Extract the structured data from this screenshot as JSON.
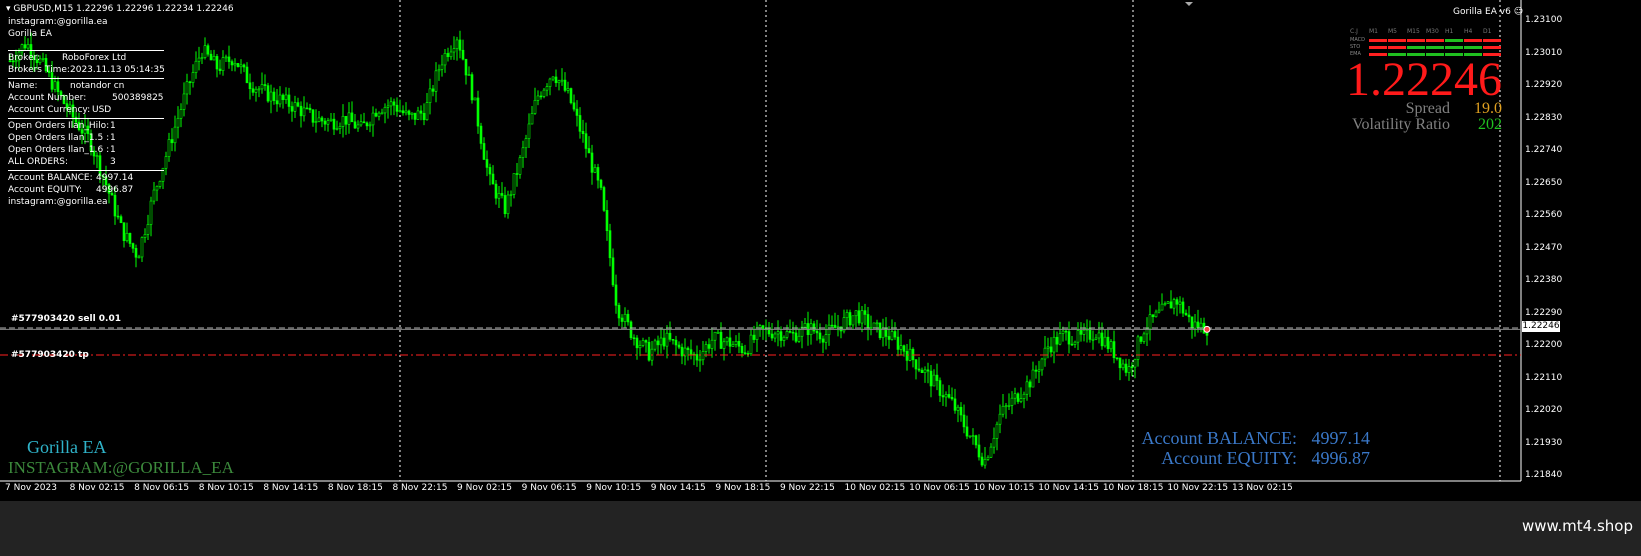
{
  "header": {
    "symbol_line": "GBPUSD,M15  1.22296 1.22296 1.22234 1.22246",
    "line2": "instagram:@gorilla.ea",
    "line3": "Gorilla EA",
    "ea_badge": "Gorilla EA  v6"
  },
  "info_panel": {
    "broker_label": "Broker:",
    "broker_value": "RoboForex Ltd",
    "broker_time_label": "Brokers Time:",
    "broker_time_value": "2023.11.13 05:14:35",
    "name_label": "Name:",
    "name_value": "notandor cn",
    "account_number_label": "Account Number:",
    "account_number_value": "500389825",
    "account_currency_label": "Account Currency:",
    "account_currency_value": "USD",
    "orders": [
      {
        "label": "Open Orders Ilan_Hilo:",
        "value": "1"
      },
      {
        "label": "Open Orders Ilan_1.5 :",
        "value": "1"
      },
      {
        "label": "Open Orders Ilan_1.6 :",
        "value": "1"
      },
      {
        "label": "ALL ORDERS:",
        "value": "3"
      }
    ],
    "balance_label": "Account BALANCE:",
    "balance_value": "4997.14",
    "equity_label": "Account EQUITY:",
    "equity_value": "4996.87",
    "footer_line": "instagram:@gorilla.ea"
  },
  "order_lines": {
    "sell_label": "#577903420 sell 0.01",
    "tp_label": "#577903420 tp"
  },
  "indicator_panel": {
    "timeframes": [
      "C.J",
      "M1",
      "M5",
      "M15",
      "M30",
      "H1",
      "H4",
      "D1"
    ],
    "rows": [
      "MACD",
      "STO",
      "EMA"
    ],
    "price": "1.22246",
    "spread_label": "Spread",
    "spread_value": "19.0",
    "volatility_label": "Volatility Ratio",
    "volatility_value": "202",
    "colors": {
      "price": "#ff1a1a",
      "spread": "#e0a020",
      "volatility": "#20c020",
      "labels": "#808080"
    }
  },
  "watermark": {
    "title": "Gorilla EA",
    "instagram": "INSTAGRAM:@GORILLA_EA"
  },
  "account_summary": {
    "balance_label": "Account BALANCE:",
    "balance_value": "4997.14",
    "equity_label": "Account EQUITY:",
    "equity_value": "4996.87"
  },
  "price_axis": {
    "ticks": [
      "1.23100",
      "1.23010",
      "1.22920",
      "1.22830",
      "1.22740",
      "1.22650",
      "1.22560",
      "1.22470",
      "1.22380",
      "1.22290",
      "1.22200",
      "1.22110",
      "1.22020",
      "1.21930",
      "1.21840"
    ],
    "current_price": "1.22246"
  },
  "time_axis": {
    "ticks": [
      "7 Nov 2023",
      "8 Nov 02:15",
      "8 Nov 06:15",
      "8 Nov 10:15",
      "8 Nov 14:15",
      "8 Nov 18:15",
      "8 Nov 22:15",
      "9 Nov 02:15",
      "9 Nov 06:15",
      "9 Nov 10:15",
      "9 Nov 14:15",
      "9 Nov 18:15",
      "9 Nov 22:15",
      "10 Nov 02:15",
      "10 Nov 06:15",
      "10 Nov 10:15",
      "10 Nov 14:15",
      "10 Nov 18:15",
      "10 Nov 22:15",
      "13 Nov 02:15"
    ]
  },
  "chart_data": {
    "type": "candlestick",
    "symbol": "GBPUSD",
    "timeframe": "M15",
    "close_path": [
      1.2299,
      1.2304,
      1.2298,
      1.229,
      1.2283,
      1.2277,
      1.2265,
      1.2252,
      1.2245,
      1.2262,
      1.2276,
      1.229,
      1.2302,
      1.2297,
      1.23,
      1.2293,
      1.229,
      1.2288,
      1.2286,
      1.2283,
      1.2282,
      1.2283,
      1.228,
      1.2286,
      1.2287,
      1.2283,
      1.2285,
      1.2299,
      1.2306,
      1.2289,
      1.2266,
      1.2258,
      1.2272,
      1.2289,
      1.2296,
      1.2289,
      1.2276,
      1.2262,
      1.2231,
      1.2223,
      1.2218,
      1.2222,
      1.2219,
      1.2217,
      1.2222,
      1.2221,
      1.2219,
      1.2224,
      1.2224,
      1.2223,
      1.2225,
      1.2223,
      1.2226,
      1.2229,
      1.2225,
      1.2223,
      1.2219,
      1.2214,
      1.2209,
      1.2204,
      1.2196,
      1.2188,
      1.2201,
      1.2206,
      1.2211,
      1.222,
      1.2223,
      1.2222,
      1.2224,
      1.2219,
      1.2213,
      1.2225,
      1.2229,
      1.2233,
      1.2226,
      1.2225
    ],
    "current_price": 1.22246,
    "sell_order_price": 1.2225,
    "tp_price": 1.22175,
    "ylim": [
      1.2184,
      1.231
    ],
    "colors": {
      "candles": "#00ff00",
      "grid": "#ffffff",
      "tp_line": "#ff2020",
      "order_line": "#b0b0b0"
    }
  },
  "footer": {
    "brand": "www.mt4.shop"
  }
}
